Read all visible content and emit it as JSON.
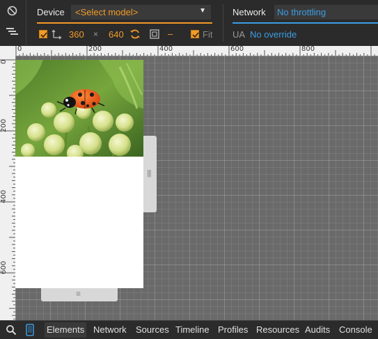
{
  "emulation": {
    "device_label": "Device",
    "model_select": "<Select model>",
    "width": "360",
    "times": "×",
    "height": "640",
    "dpr": "–",
    "fit_label": "Fit",
    "network_label": "Network",
    "throttling": "No throttling",
    "ua_label": "UA",
    "ua_value": "No override",
    "accent_color": "#f29b27",
    "link_color": "#3b9de4"
  },
  "ruler": {
    "top_ticks": [
      "0",
      "200",
      "400",
      "600",
      "800"
    ],
    "left_ticks": [
      "0",
      "200",
      "400",
      "600"
    ]
  },
  "viewport_image": "ladybug on yellow-green flower buds",
  "tabs": [
    {
      "label": "Elements",
      "active": true
    },
    {
      "label": "Network"
    },
    {
      "label": "Sources"
    },
    {
      "label": "Timeline"
    },
    {
      "label": "Profiles"
    },
    {
      "label": "Resources"
    },
    {
      "label": "Audits"
    },
    {
      "label": "Console"
    }
  ]
}
